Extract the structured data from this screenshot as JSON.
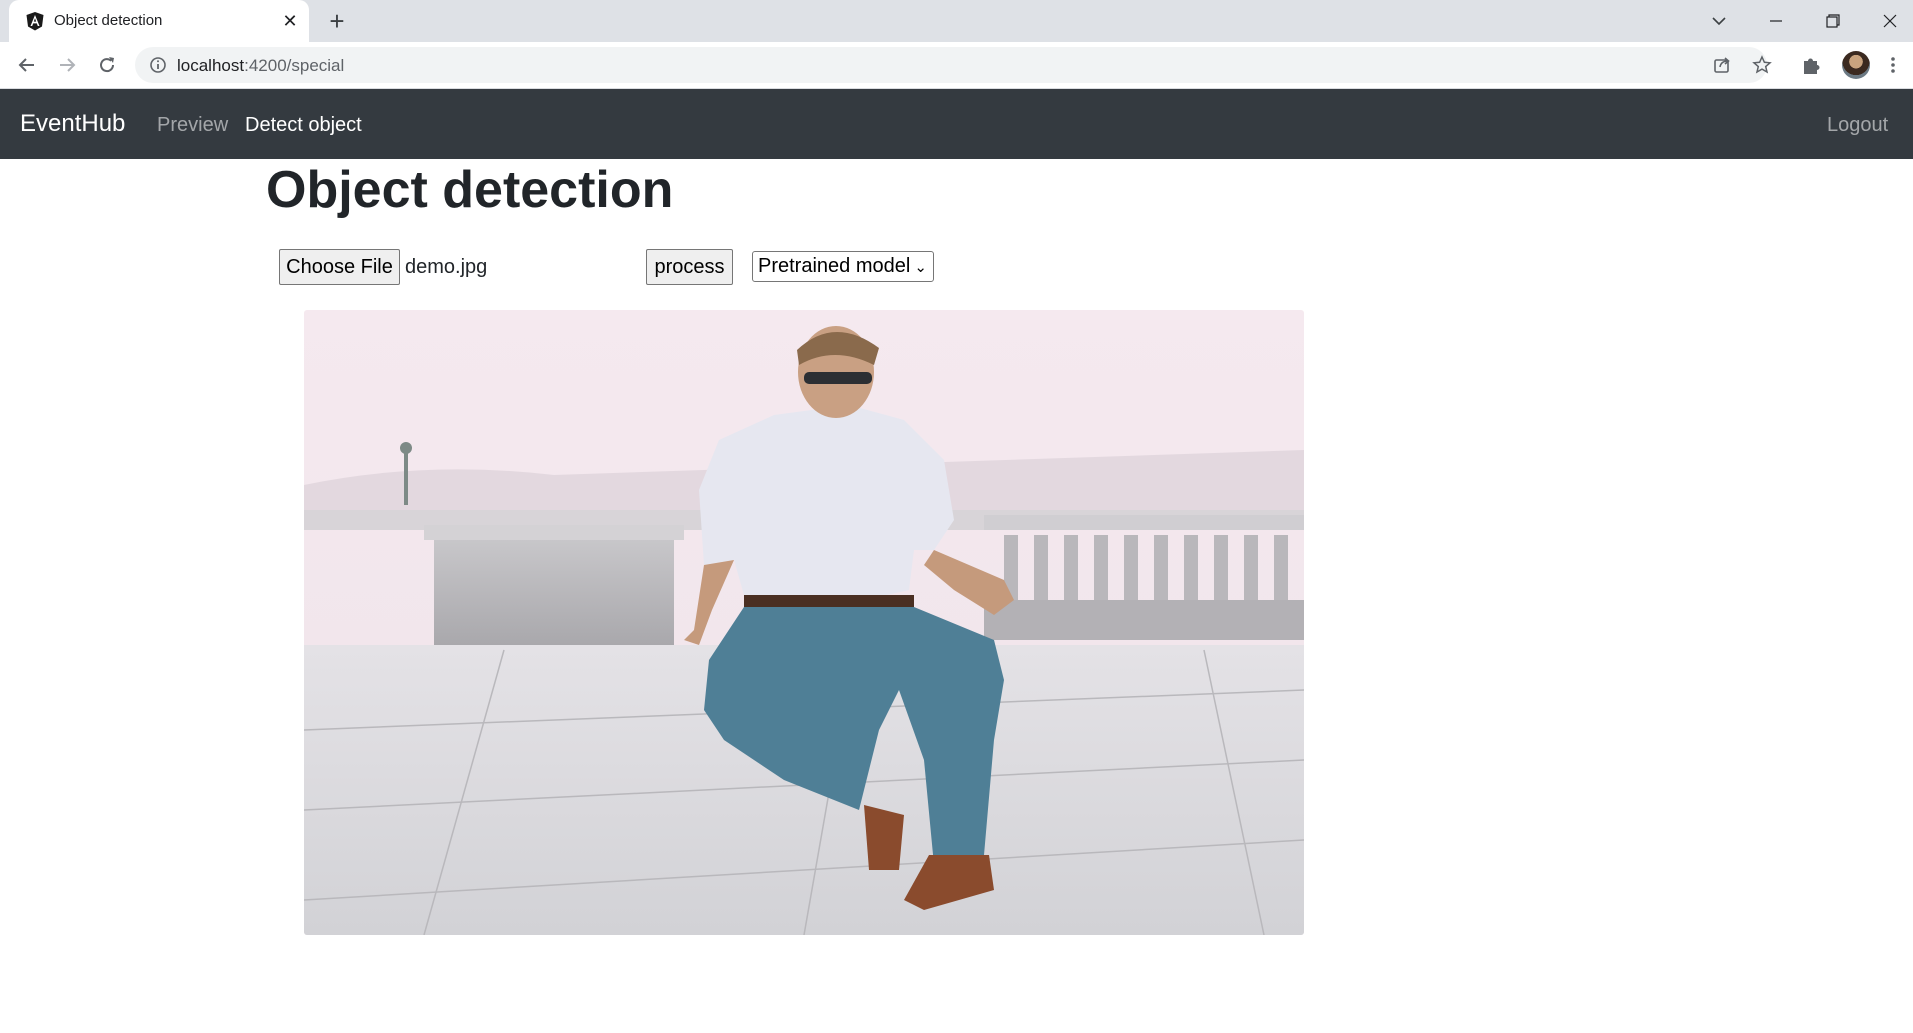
{
  "browser": {
    "tab_title": "Object detection",
    "url_host": "localhost",
    "url_rest": ":4200/special"
  },
  "navbar": {
    "brand": "EventHub",
    "links": [
      "Preview",
      "Detect object"
    ],
    "logout": "Logout"
  },
  "main": {
    "title": "Object detection",
    "choose_file_label": "Choose File",
    "file_name": "demo.jpg",
    "process_label": "process",
    "model_selected": "Pretrained model"
  },
  "icons": {
    "tab": "angular-icon",
    "back": "arrow-left-icon",
    "forward": "arrow-right-icon",
    "reload": "reload-icon",
    "share": "share-icon",
    "bookmark": "star-icon",
    "extensions": "puzzle-icon",
    "menu": "kebab-menu-icon"
  },
  "colors": {
    "navbar_bg": "#343a40",
    "link_muted": "rgba(255,255,255,0.55)",
    "title_text": "#212529"
  }
}
